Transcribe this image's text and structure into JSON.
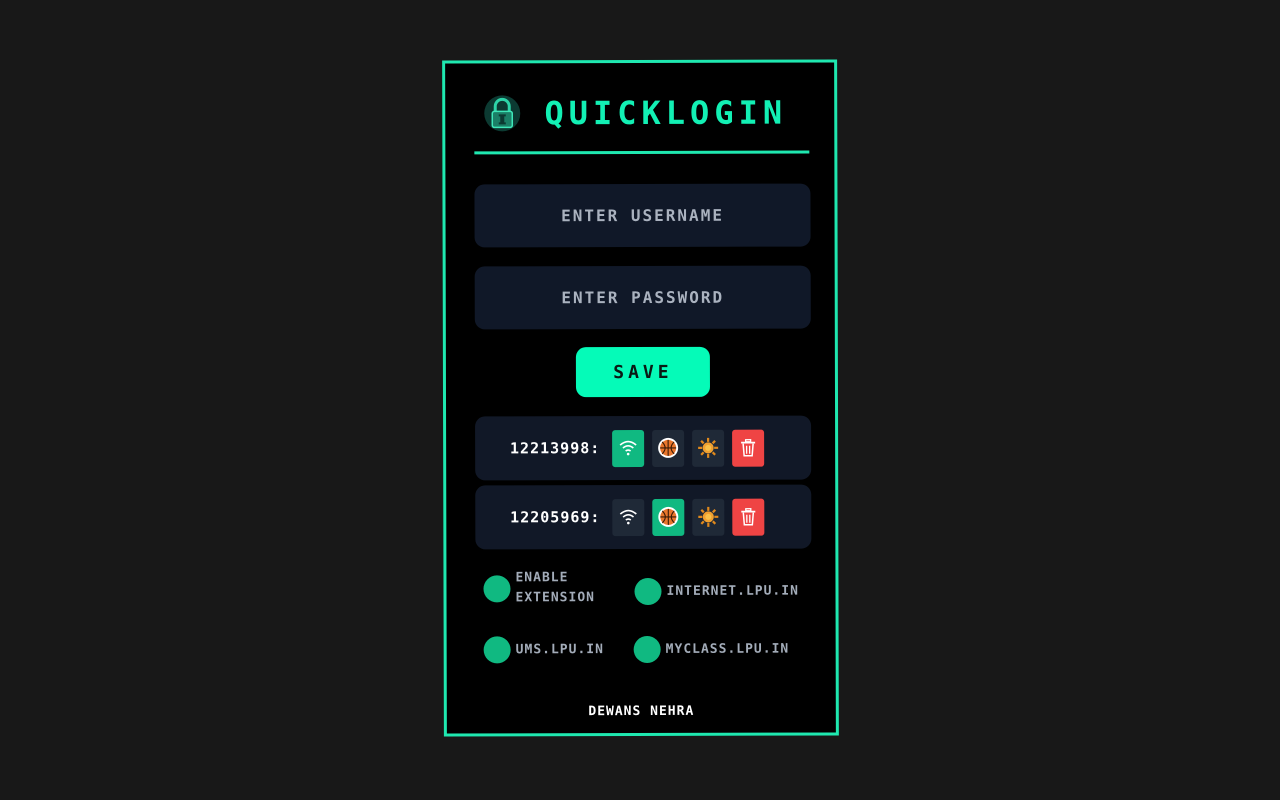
{
  "app": {
    "title": "QUICKLOGIN"
  },
  "form": {
    "username_placeholder": "ENTER USERNAME",
    "password_placeholder": "ENTER PASSWORD",
    "save_label": "SAVE"
  },
  "accounts": [
    {
      "label": "12213998:",
      "active_site": "internet"
    },
    {
      "label": "12205969:",
      "active_site": "myclass"
    }
  ],
  "account_buttons": [
    {
      "icon": "wifi-icon"
    },
    {
      "icon": "basketball-icon"
    },
    {
      "icon": "sun-icon"
    },
    {
      "icon": "trash-icon"
    }
  ],
  "toggles": [
    {
      "label": "ENABLE EXTENSION"
    },
    {
      "label": "INTERNET.LPU.IN"
    },
    {
      "label": "UMS.LPU.IN"
    },
    {
      "label": "MYCLASS.LPU.IN"
    }
  ],
  "footer": {
    "author": "DEWANS NEHRA"
  },
  "colors": {
    "accent": "#1fe8b0",
    "save": "#05fbb8",
    "active": "#10b981",
    "delete": "#ef4444",
    "field": "#101828"
  }
}
